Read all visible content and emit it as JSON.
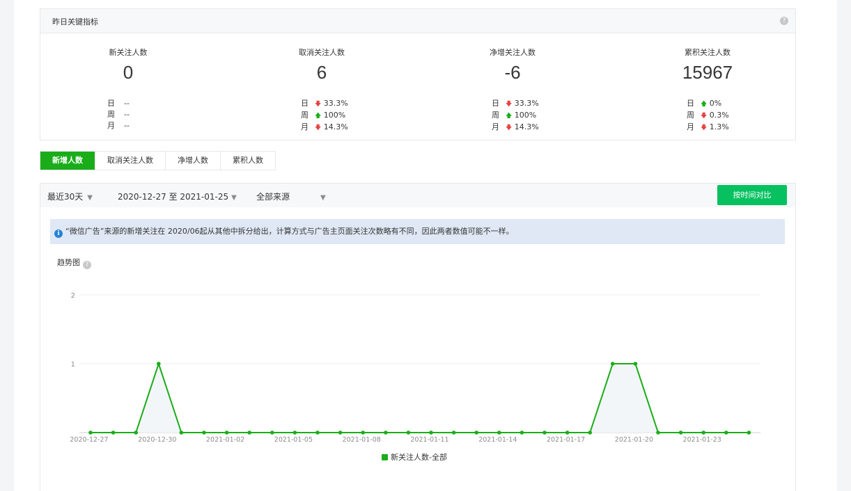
{
  "key_metrics": {
    "title": "昨日关键指标",
    "help_glyph": "?",
    "period_labels": [
      "日",
      "周",
      "月"
    ],
    "metrics": [
      {
        "label": "新关注人数",
        "value": "0",
        "changes": [
          {
            "dir": "none",
            "text": "--"
          },
          {
            "dir": "none",
            "text": "--"
          },
          {
            "dir": "none",
            "text": "--"
          }
        ]
      },
      {
        "label": "取消关注人数",
        "value": "6",
        "changes": [
          {
            "dir": "down",
            "text": "33.3%"
          },
          {
            "dir": "up",
            "text": "100%"
          },
          {
            "dir": "down",
            "text": "14.3%"
          }
        ]
      },
      {
        "label": "净增关注人数",
        "value": "-6",
        "changes": [
          {
            "dir": "down",
            "text": "33.3%"
          },
          {
            "dir": "up",
            "text": "100%"
          },
          {
            "dir": "down",
            "text": "14.3%"
          }
        ]
      },
      {
        "label": "累积关注人数",
        "value": "15967",
        "changes": [
          {
            "dir": "up",
            "text": "0%"
          },
          {
            "dir": "down",
            "text": "0.3%"
          },
          {
            "dir": "down",
            "text": "1.3%"
          }
        ]
      }
    ]
  },
  "tabs": [
    {
      "label": "新增人数",
      "active": true
    },
    {
      "label": "取消关注人数",
      "active": false
    },
    {
      "label": "净增人数",
      "active": false
    },
    {
      "label": "累积人数",
      "active": false
    }
  ],
  "filters": {
    "range": "最近30天",
    "dates": "2020-12-27 至 2021-01-25",
    "source": "全部来源",
    "compare_button": "按时间对比"
  },
  "notice": {
    "icon": "i",
    "text": "“微信广告”来源的新增关注在 2020/06起从其他中拆分给出，计算方式与广告主页面关注次数略有不同，因此两者数值可能不一样。"
  },
  "trend": {
    "title": "趋势图"
  },
  "colors": {
    "accent": "#1aad19",
    "button": "#07c160",
    "up": "#1aad19",
    "down": "#e64340",
    "notice_bg": "#dfe8f4"
  },
  "chart_data": {
    "type": "line",
    "x": [
      "2020-12-27",
      "2020-12-28",
      "2020-12-29",
      "2020-12-30",
      "2020-12-31",
      "2021-01-01",
      "2021-01-02",
      "2021-01-03",
      "2021-01-04",
      "2021-01-05",
      "2021-01-06",
      "2021-01-07",
      "2021-01-08",
      "2021-01-09",
      "2021-01-10",
      "2021-01-11",
      "2021-01-12",
      "2021-01-13",
      "2021-01-14",
      "2021-01-15",
      "2021-01-16",
      "2021-01-17",
      "2021-01-18",
      "2021-01-19",
      "2021-01-20",
      "2021-01-21",
      "2021-01-22",
      "2021-01-23",
      "2021-01-24",
      "2021-01-25"
    ],
    "x_tick_labels": [
      "2020-12-27",
      "2020-12-30",
      "2021-01-02",
      "2021-01-05",
      "2021-01-08",
      "2021-01-11",
      "2021-01-14",
      "2021-01-17",
      "2021-01-20",
      "2021-01-23"
    ],
    "series": [
      {
        "name": "新关注人数-全部",
        "color": "#1aad19",
        "values": [
          0,
          0,
          0,
          1,
          0,
          0,
          0,
          0,
          0,
          0,
          0,
          0,
          0,
          0,
          0,
          0,
          0,
          0,
          0,
          0,
          0,
          0,
          0,
          1,
          1,
          0,
          0,
          0,
          0,
          0
        ]
      }
    ],
    "y_ticks": [
      "1",
      "2"
    ],
    "ylim": [
      0,
      2
    ],
    "grid": true,
    "legend": "bottom-center"
  }
}
